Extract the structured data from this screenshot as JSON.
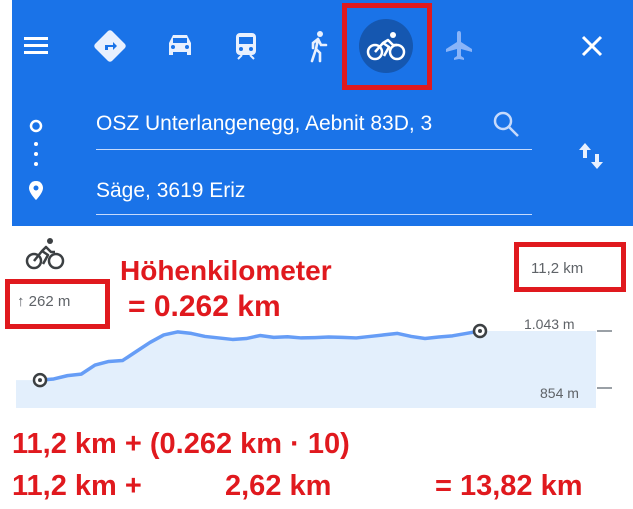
{
  "header": {
    "bg_color": "#1a73e8",
    "menu_icon": "hamburger-menu-icon",
    "modes": [
      {
        "name": "best-route",
        "icon": "diamond-turn-icon"
      },
      {
        "name": "car",
        "icon": "car-icon"
      },
      {
        "name": "transit",
        "icon": "train-icon"
      },
      {
        "name": "walking",
        "icon": "walking-icon"
      },
      {
        "name": "cycling",
        "icon": "bicycle-icon",
        "selected": true
      },
      {
        "name": "flight",
        "icon": "airplane-icon"
      }
    ],
    "close_icon": "close-icon"
  },
  "route": {
    "origin": "OSZ Unterlangenegg, Aebnit 83D, 3",
    "destination": "Säge, 3619 Eriz",
    "swap_icon": "swap-vertical-icon",
    "search_icon": "search-icon"
  },
  "profile": {
    "mode_icon": "bicycle-icon",
    "ascent": "↑ 262 m",
    "distance": "11,2 km",
    "max_elevation": "1.043 m",
    "min_elevation": "854 m",
    "elevation_series": [
      880,
      884,
      895,
      900,
      930,
      942,
      945,
      975,
      1005,
      1030,
      1040,
      1035,
      1025,
      1020,
      1015,
      1018,
      1028,
      1022,
      1024,
      1020,
      1021,
      1023,
      1022,
      1020,
      1025,
      1030,
      1035,
      1025,
      1018,
      1023,
      1027,
      1035,
      1043
    ]
  },
  "annotation": {
    "title": "Höhenkilometer",
    "equals": "= 0.262 km",
    "formula_line1": "11,2 km + (0.262 km · 10)",
    "formula_line2a": "11,2 km +",
    "formula_line2b": "2,62 km",
    "formula_line2c": "= 13,82 km",
    "highlight_color": "#e0191e"
  }
}
